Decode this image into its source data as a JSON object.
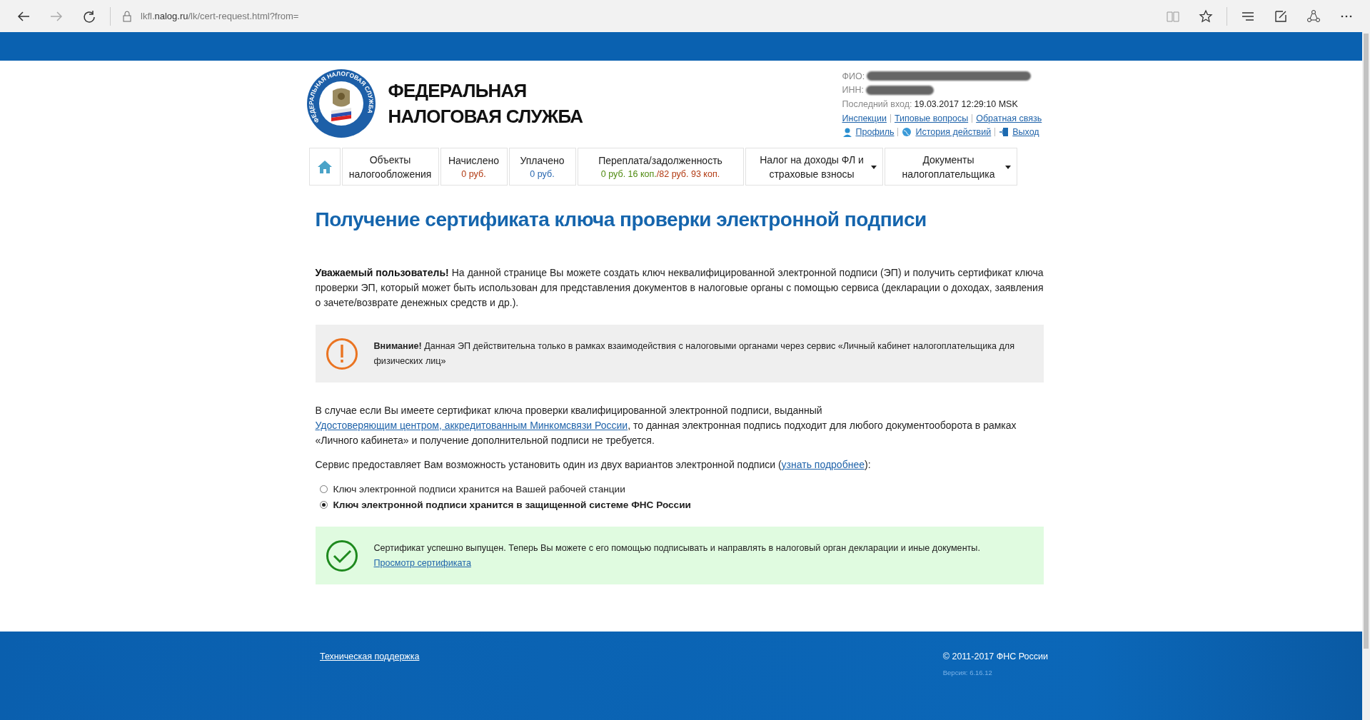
{
  "browser": {
    "url": "lkfl.**nalog.ru**/lk/cert-request.html?from="
  },
  "header": {
    "emblem_text": "ФЕДЕРАЛЬНАЯ НАЛОГОВАЯ СЛУЖБА",
    "title_lines": [
      "ФЕДЕРАЛЬНАЯ",
      "НАЛОГОВАЯ СЛУЖБА"
    ],
    "user": {
      "fio_label": "ФИО:",
      "inn_label": "ИНН:",
      "last_login_label": "Последний вход:",
      "last_login": "19.03.2017 12:29:10 MSK",
      "links": [
        "Инспекции",
        "Типовые вопросы",
        "Обратная связь"
      ],
      "actions": [
        {
          "kind": "profile",
          "label": "Профиль"
        },
        {
          "kind": "history",
          "label": "История действий"
        },
        {
          "kind": "exit",
          "label": "Выход"
        }
      ]
    }
  },
  "nav": [
    {
      "kind": "home"
    },
    {
      "kind": "item",
      "label": "Объекты налогообложения",
      "dropdown": false
    },
    {
      "kind": "item",
      "label": "Начислено",
      "amounts": [
        {
          "text": "0 руб.",
          "color": "#b23a12"
        }
      ],
      "dropdown": false
    },
    {
      "kind": "item",
      "label": "Уплачено",
      "amounts": [
        {
          "text": "0 руб.",
          "color": "#2a68b0"
        }
      ],
      "dropdown": false
    },
    {
      "kind": "item",
      "label": "Переплата/задолженность",
      "amounts": [
        {
          "text": "0 руб. 16 коп.",
          "color": "#4f8a10"
        },
        {
          "text": "/82 руб. 93 коп.",
          "color": "#b23a12"
        }
      ],
      "dropdown": false
    },
    {
      "kind": "item",
      "label": "Налог на доходы ФЛ и страховые взносы",
      "dropdown": true
    },
    {
      "kind": "item",
      "label": "Документы налогоплательщика",
      "dropdown": true
    }
  ],
  "title": "Получение сертификата ключа проверки электронной подписи",
  "intro": "**Уважаемый пользователь!** На данной странице Вы можете создать ключ неквалифицированной электронной подписи (ЭП) и получить сертификат ключа проверки ЭП, который может быть использован для представления документов в налоговые органы с помощью сервиса (декларации о доходах, заявления о зачете/возврате денежных средств и др.).",
  "warning": {
    "kind": "warning",
    "text": "**Внимание!** Данная ЭП действительна только в рамках взаимодействия с налоговыми органами через сервис «Личный кабинет налогоплательщика для физических лиц»"
  },
  "qualified": {
    "before": "В случае если Вы имеете сертификат ключа проверки квалифицированной электронной подписи, выданный ",
    "link": "Удостоверяющим центром, аккредитованным Минкомсвязи России",
    "after": ", то данная электронная подпись подходит для любого документооборота в рамках «Личного кабинета» и получение дополнительной подписи не требуется."
  },
  "options_intro": {
    "before": "Сервис предоставляет Вам возможность установить один из двух вариантов электронной подписи (",
    "link": "узнать подробнее",
    "after": "):"
  },
  "options": [
    {
      "label": "Ключ электронной подписи хранится на Вашей рабочей станции",
      "selected": false
    },
    {
      "label": "Ключ электронной подписи хранится в защищенной системе ФНС России",
      "selected": true
    }
  ],
  "success": {
    "kind": "success",
    "text": "Сертификат успешно выпущен. Теперь Вы можете с его помощью подписывать и направлять в налоговый орган декларации и иные документы.",
    "link": "Просмотр сертификата"
  },
  "footer": {
    "support_link": "Техническая поддержка",
    "copyright": "© 2011-2017 ФНС России",
    "version": "Версия: 6.16.12"
  }
}
